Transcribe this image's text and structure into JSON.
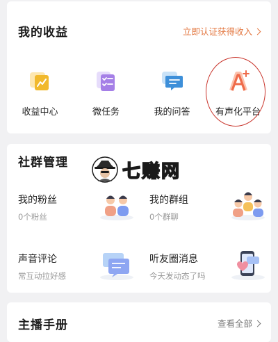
{
  "earnings": {
    "title": "我的收益",
    "verify_link": "立即认证获得收入",
    "items": [
      {
        "label": "收益中心",
        "icon": "income-chart-icon",
        "color": "#f1b92c"
      },
      {
        "label": "微任务",
        "icon": "task-list-icon",
        "color": "#a57fe7"
      },
      {
        "label": "我的问答",
        "icon": "qa-chat-icon",
        "color": "#3d8fd9"
      },
      {
        "label": "有声化平台",
        "icon": "audio-platform-icon",
        "color": "#ef6b4a"
      }
    ]
  },
  "community": {
    "title": "社群管理",
    "cells": [
      {
        "title": "我的粉丝",
        "subtitle": "0个粉丝",
        "icon": "fans-illustration-icon"
      },
      {
        "title": "我的群组",
        "subtitle": "0个群聊",
        "icon": "group-illustration-icon"
      },
      {
        "title": "声音评论",
        "subtitle": "常互动拉好感",
        "icon": "comment-illustration-icon"
      },
      {
        "title": "听友圈消息",
        "subtitle": "今天发动态了吗",
        "icon": "moments-illustration-icon"
      }
    ]
  },
  "anchor_manual": {
    "title": "主播手册",
    "view_all": "查看全部"
  },
  "watermark": {
    "text": "七赚网"
  },
  "colors": {
    "accent_orange": "#e3763f",
    "annotation_red": "#c9352c",
    "muted": "#999999"
  }
}
